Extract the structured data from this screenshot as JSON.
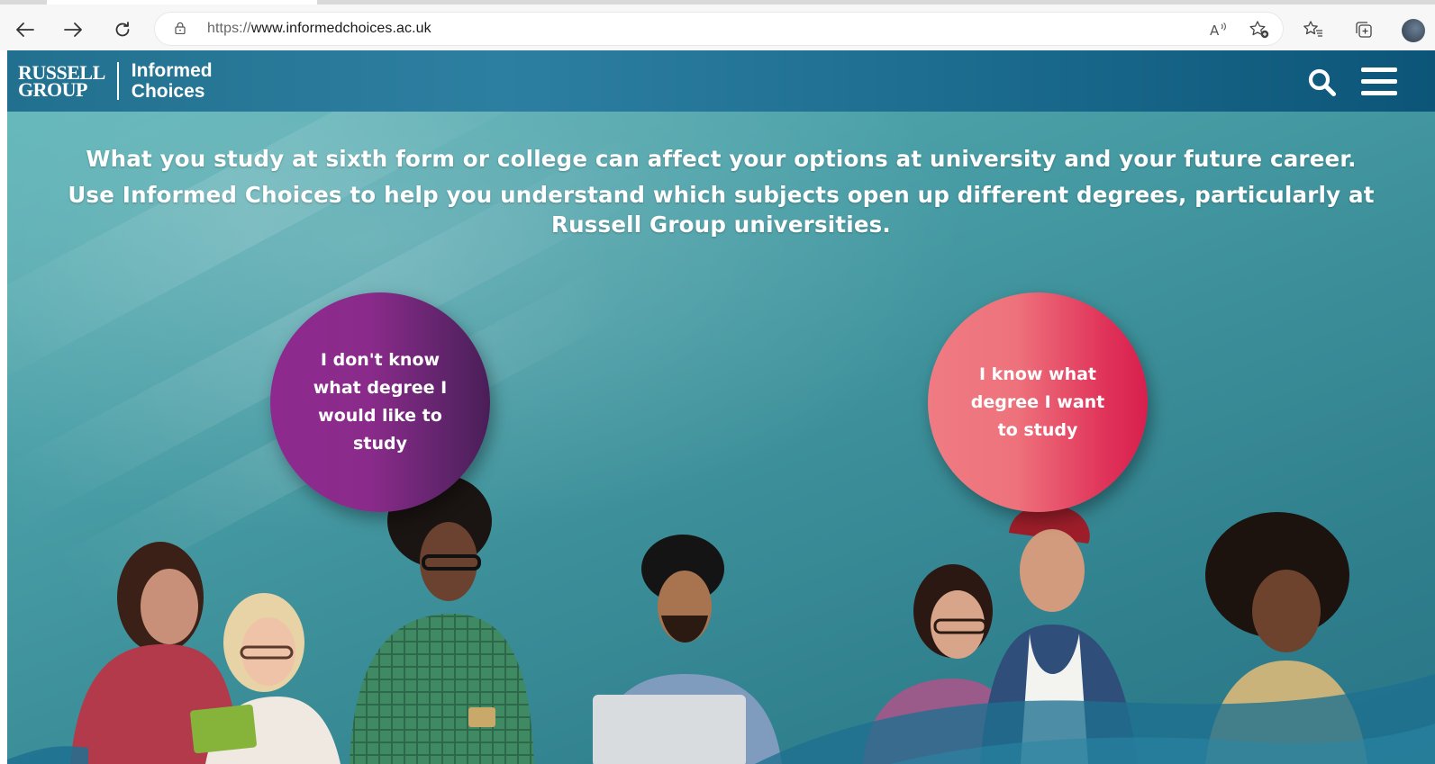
{
  "browser": {
    "url_protocol": "https://",
    "url_host": "www.informedchoices.ac.uk",
    "read_aloud_icon": "Aᵃ",
    "icons": [
      "back-arrow-icon",
      "forward-arrow-icon",
      "refresh-icon",
      "lock-icon",
      "read-aloud-icon",
      "add-favorite-icon",
      "favorites-icon",
      "collections-icon",
      "profile-avatar"
    ]
  },
  "header": {
    "logo_line1": "RUSSELL",
    "logo_line2": "GROUP",
    "brand_line1": "Informed",
    "brand_line2": "Choices",
    "icons": [
      "search-icon",
      "hamburger-menu-icon"
    ]
  },
  "hero": {
    "line1": "What you study at sixth form or college can affect your options at university and your future career.",
    "line2": "Use Informed Choices to help you understand which subjects open up different degrees, particularly at Russell Group universities.",
    "choice_left": "I don't know what degree I would like to study",
    "choice_right": "I know what degree I want to study"
  },
  "colors": {
    "header_blue": "#1a6a8d",
    "hero_teal": "#4a9fa7",
    "circle_purple": "#8a2b8b",
    "circle_pink": "#e0345a"
  }
}
